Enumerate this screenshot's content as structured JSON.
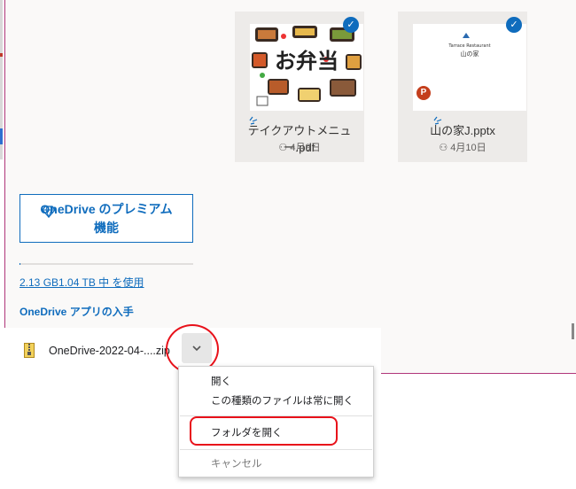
{
  "sidebar": {
    "premium_button": "OneDrive のプレミアム機能",
    "storage_fill": 0.002,
    "storage_text": "2.13 GB1.04 TB 中 を使用",
    "get_apps": "OneDrive アプリの入手"
  },
  "files": [
    {
      "thumb_title": "お弁当",
      "name": "テイクアウトメニュー.pdf",
      "date": "4月9日"
    },
    {
      "thumb_line1": "Tarrace Restaurant",
      "thumb_line2": "山の家",
      "name": "山の家J.pptx",
      "date": "4月10日"
    }
  ],
  "download": {
    "filename": "OneDrive-2022-04-....zip"
  },
  "menu": {
    "open": "開く",
    "always_open": "この種類のファイルは常に開く",
    "open_folder": "フォルダを開く",
    "cancel": "キャンセル"
  },
  "colors": {
    "accent": "#0f6cbd",
    "highlight": "#e8111a",
    "frame": "#b0367a"
  }
}
